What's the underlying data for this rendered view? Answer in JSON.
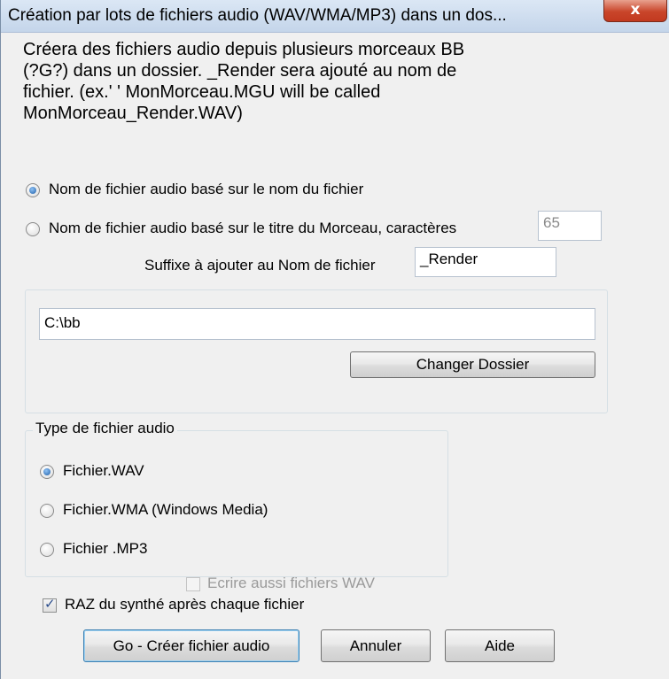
{
  "window": {
    "title": "Création par lots de fichiers audio (WAV/WMA/MP3) dans un dos...",
    "close_glyph": "x"
  },
  "description": {
    "lines": [
      "Créera des fichiers audio depuis plusieurs morceaux BB",
      "(?G?) dans un dossier.  _Render sera ajouté au nom de",
      "fichier. (ex.'         ' MonMorceau.MGU will be called",
      "MonMorceau_Render.WAV)"
    ]
  },
  "naming": {
    "option_filename": {
      "label": "Nom de fichier audio basé sur le nom du fichier",
      "checked": true
    },
    "option_title": {
      "label": "Nom de fichier audio basé sur le titre du  Morceau,  caractères",
      "checked": false
    },
    "chars_value": "65",
    "suffix_label": "Suffixe à ajouter au Nom de fichier",
    "suffix_value": "_Render"
  },
  "folder": {
    "path": "C:\\bb",
    "change_button": "Changer Dossier"
  },
  "filetype": {
    "legend": "Type de fichier audio",
    "options": [
      {
        "label": "Fichier.WAV",
        "checked": true
      },
      {
        "label": "Fichier.WMA  (Windows Media)",
        "checked": false
      },
      {
        "label": "Fichier .MP3",
        "checked": false
      }
    ],
    "also_wav": {
      "label": "Ecrire aussi fichiers WAV",
      "checked": false,
      "enabled": false
    }
  },
  "reset_synth": {
    "label": "RAZ du synthé après chaque fichier",
    "checked": true
  },
  "buttons": {
    "go": "Go - Créer fichier audio",
    "cancel": "Annuler",
    "help": "Aide"
  }
}
